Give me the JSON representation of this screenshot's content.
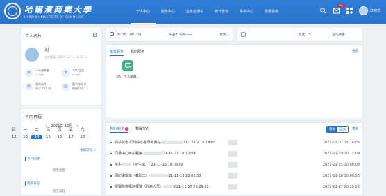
{
  "header": {
    "university_cn": "哈爾濱商業大學",
    "university_en": "HARBIN UNIVERSITY OF COMMERCE",
    "nav": [
      "个人中心",
      "服务中心",
      "业务直通车",
      "统计查询",
      "事务中心",
      "数据看板"
    ],
    "badge": "99+",
    "user_name": "欢迎您"
  },
  "profile": {
    "title": "个人名片",
    "name": "刘",
    "last_login": "上次登录：2021-12-14 19:07:14",
    "stats": [
      {
        "label": "一卡通余额",
        "value": "--.--元"
      },
      {
        "label": "12月工资",
        "value": "--.--元"
      },
      {
        "label": "我的邮件",
        "value": "未读 251 封"
      },
      {
        "label": "图书借阅书",
        "value": "借阅 0 本"
      }
    ]
  },
  "calendar_card": {
    "title": "日历日程",
    "month_label": "2021年  12月",
    "weekdays": [
      "日",
      "一",
      "二",
      "三",
      "四",
      "五",
      "六"
    ],
    "days": [
      "12",
      "13",
      "14",
      "15",
      "16",
      "17",
      "18"
    ],
    "today": "14",
    "add_label": "添加日程 +",
    "today_section": "今日提醒",
    "empty_today": "暂无提醒",
    "upcoming_section": "我的日程",
    "empty_upcoming": "暂无日程"
  },
  "datebar": {
    "date": "2021年12月14日",
    "lunar": "辛丑年 冬月十一",
    "weekday": "星期二"
  },
  "weather": {
    "temp": "温度：℃",
    "air": "空气质量："
  },
  "apps": {
    "tabs": [
      "推荐服务",
      "我的服务"
    ],
    "more": "更多",
    "items": [
      {
        "label": "OA、个人邮箱...",
        "icon": "chat-icon"
      }
    ]
  },
  "tasks": {
    "tabs": [
      "我的待办",
      "我提交的"
    ],
    "badge": "3",
    "toggle": [
      "待办",
      "已办"
    ],
    "more": "更多",
    "rows": [
      {
        "title": "测试状态-同场中心警承收藏站-",
        "tail": "21-12-02 15:14:05",
        "date": "2021-12-02 15:14:05"
      },
      {
        "title": "同场中心维护程序-",
        "tail": "21-11-29 10:12:09",
        "date": "2021-11-29 10:12:09"
      },
      {
        "title": "学生",
        "tail": "（学生端）-     21-11-25 10:08:08",
        "date": "2021-11-25 10:08:08"
      },
      {
        "title": "网印审批单（教职工）-",
        "tail": "21-11-18 10:06:53",
        "date": "2021-11-18 10:06:53"
      },
      {
        "title": "报警防盗报站报警（外来人员）-",
        "tail": "021-11-17 20:29:22",
        "date": "2021-11-17 20:29:22"
      }
    ]
  }
}
